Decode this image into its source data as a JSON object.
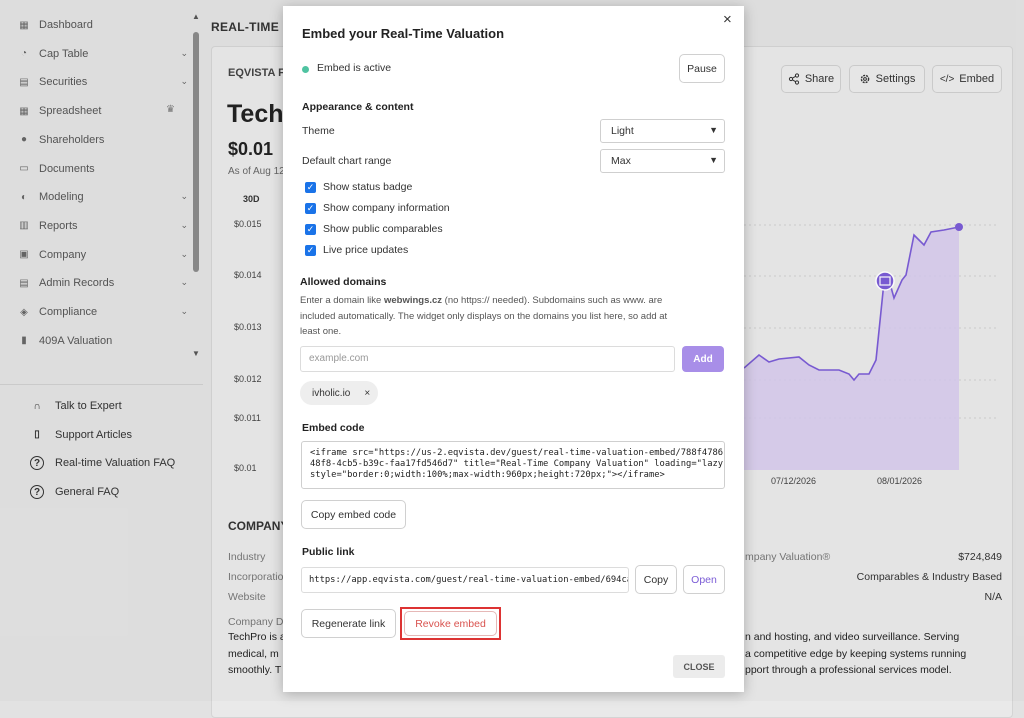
{
  "sidebar": {
    "items": [
      {
        "label": "Dashboard",
        "icon": "dashboard-icon",
        "chevron": false
      },
      {
        "label": "Cap Table",
        "icon": "pie-chart-icon",
        "chevron": true
      },
      {
        "label": "Securities",
        "icon": "document-icon",
        "chevron": true
      },
      {
        "label": "Spreadsheet",
        "icon": "spreadsheet-icon",
        "chevron": false,
        "badge": "crown"
      },
      {
        "label": "Shareholders",
        "icon": "user-icon",
        "chevron": false
      },
      {
        "label": "Documents",
        "icon": "folder-icon",
        "chevron": false
      },
      {
        "label": "Modeling",
        "icon": "lightbulb-icon",
        "chevron": true
      },
      {
        "label": "Reports",
        "icon": "chart-icon",
        "chevron": true
      },
      {
        "label": "Company",
        "icon": "building-icon",
        "chevron": true
      },
      {
        "label": "Admin Records",
        "icon": "records-icon",
        "chevron": true
      },
      {
        "label": "Compliance",
        "icon": "shield-icon",
        "chevron": true
      },
      {
        "label": "409A Valuation",
        "icon": "bar-chart-icon",
        "chevron": false
      }
    ],
    "help": [
      {
        "label": "Talk to Expert",
        "icon": "headset-icon"
      },
      {
        "label": "Support Articles",
        "icon": "book-icon"
      },
      {
        "label": "Real-time Valuation FAQ",
        "icon": "question-icon"
      },
      {
        "label": "General FAQ",
        "icon": "question-icon"
      }
    ]
  },
  "page": {
    "title": "REAL-TIME C",
    "card_header": "EQVISTA F",
    "company_name": "Tech",
    "price": "$0.01",
    "as_of": "As of Aug 12",
    "range_tab": "30D",
    "share_label": "Share",
    "settings_label": "Settings",
    "embed_label": "Embed",
    "y_ticks": [
      "$0.015",
      "$0.014",
      "$0.013",
      "$0.012",
      "$0.011",
      "$0.01"
    ],
    "x_ticks": [
      "07/12/2026",
      "08/01/2026"
    ],
    "company_section": "COMPANY",
    "details": {
      "industry_label": "Industry",
      "incorporation_label": "Incorporatio",
      "website_label": "Website",
      "description_label": "Company D",
      "valuation_label": "mpany Valuation®",
      "valuation_value": "$724,849",
      "method_value": "Comparables & Industry Based",
      "website_value": "N/A"
    },
    "description_lines": [
      {
        "left": "TechPro is a",
        "right": "n and hosting, and video surveillance. Serving"
      },
      {
        "left": "medical, m",
        "right": "a competitive edge by keeping systems running"
      },
      {
        "left": "smoothly. T",
        "right": "pport through a professional services model."
      }
    ]
  },
  "modal": {
    "title": "Embed your Real-Time Valuation",
    "close_glyph": "×",
    "status_text": "Embed is active",
    "pause_label": "Pause",
    "appearance_heading": "Appearance & content",
    "theme_label": "Theme",
    "theme_value": "Light",
    "range_label": "Default chart range",
    "range_value": "Max",
    "checkboxes": [
      {
        "label": "Show status badge",
        "checked": true
      },
      {
        "label": "Show company information",
        "checked": true
      },
      {
        "label": "Show public comparables",
        "checked": true
      },
      {
        "label": "Live price updates",
        "checked": true
      }
    ],
    "domains_heading": "Allowed domains",
    "domains_help_1": "Enter a domain like ",
    "domains_help_bold": "webwings.cz",
    "domains_help_2": " (no https:// needed). Subdomains such as www. are",
    "domains_help_3": "included automatically. The widget only displays on the domains you list here, so add at",
    "domains_help_4": "least one.",
    "domain_placeholder": "example.com",
    "add_label": "Add",
    "domain_chip": "ivholic.io",
    "chip_remove": "×",
    "embed_heading": "Embed code",
    "embed_code": "<iframe src=\"https://us-2.eqvista.dev/guest/real-time-valuation-embed/788f4786-\n48f8-4cb5-b39c-faa17fd546d7\" title=\"Real-Time Company Valuation\" loading=\"lazy\"\nstyle=\"border:0;width:100%;max-width:960px;height:720px;\"></iframe>",
    "copy_code_label": "Copy embed code",
    "public_heading": "Public link",
    "public_url": "https://app.eqvista.com/guest/real-time-valuation-embed/694ca",
    "copy_label": "Copy",
    "open_label": "Open",
    "regenerate_label": "Regenerate link",
    "revoke_label": "Revoke embed",
    "close_label": "CLOSE"
  },
  "colors": {
    "accent": "#7b5cd6",
    "status": "#4fc3a1",
    "danger": "#d9534f",
    "checkbox": "#1a73e8"
  }
}
